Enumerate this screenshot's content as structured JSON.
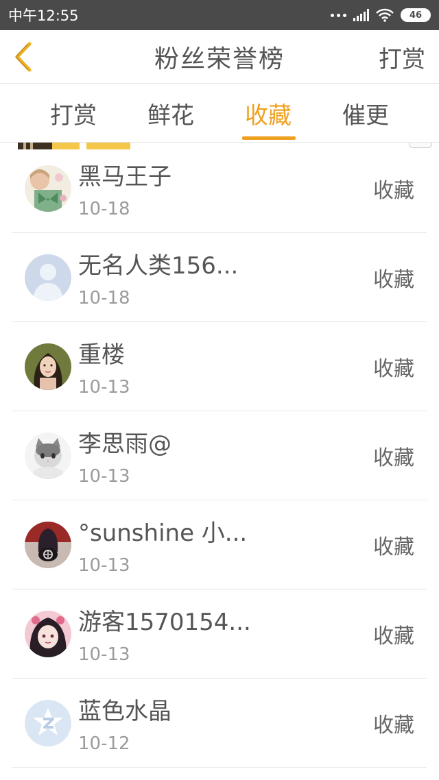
{
  "status_bar": {
    "time": "中午12:55",
    "battery": "46"
  },
  "nav": {
    "title": "粉丝荣誉榜",
    "action_label": "打赏"
  },
  "tabs": [
    {
      "label": "打赏"
    },
    {
      "label": "鲜花"
    },
    {
      "label": "收藏"
    },
    {
      "label": "催更"
    }
  ],
  "active_tab_index": 2,
  "accent_color": "#f0a020",
  "fans": [
    {
      "name": "黑马王子",
      "date": "10-18",
      "action": "收藏",
      "avatar": "anime-girl-green-avatar"
    },
    {
      "name": "无名人类156...",
      "date": "10-18",
      "action": "收藏",
      "avatar": "default-user-avatar"
    },
    {
      "name": "重楼",
      "date": "10-13",
      "action": "收藏",
      "avatar": "woman-portrait-avatar"
    },
    {
      "name": "李思雨@",
      "date": "10-13",
      "action": "收藏",
      "avatar": "kitten-avatar"
    },
    {
      "name": "°sunshine 小...",
      "date": "10-13",
      "action": "收藏",
      "avatar": "dark-hooded-avatar"
    },
    {
      "name": "游客1570154...",
      "date": "10-13",
      "action": "收藏",
      "avatar": "anime-girl-pink-avatar"
    },
    {
      "name": "蓝色水晶",
      "date": "10-12",
      "action": "收藏",
      "avatar": "qq-logo-avatar"
    }
  ]
}
